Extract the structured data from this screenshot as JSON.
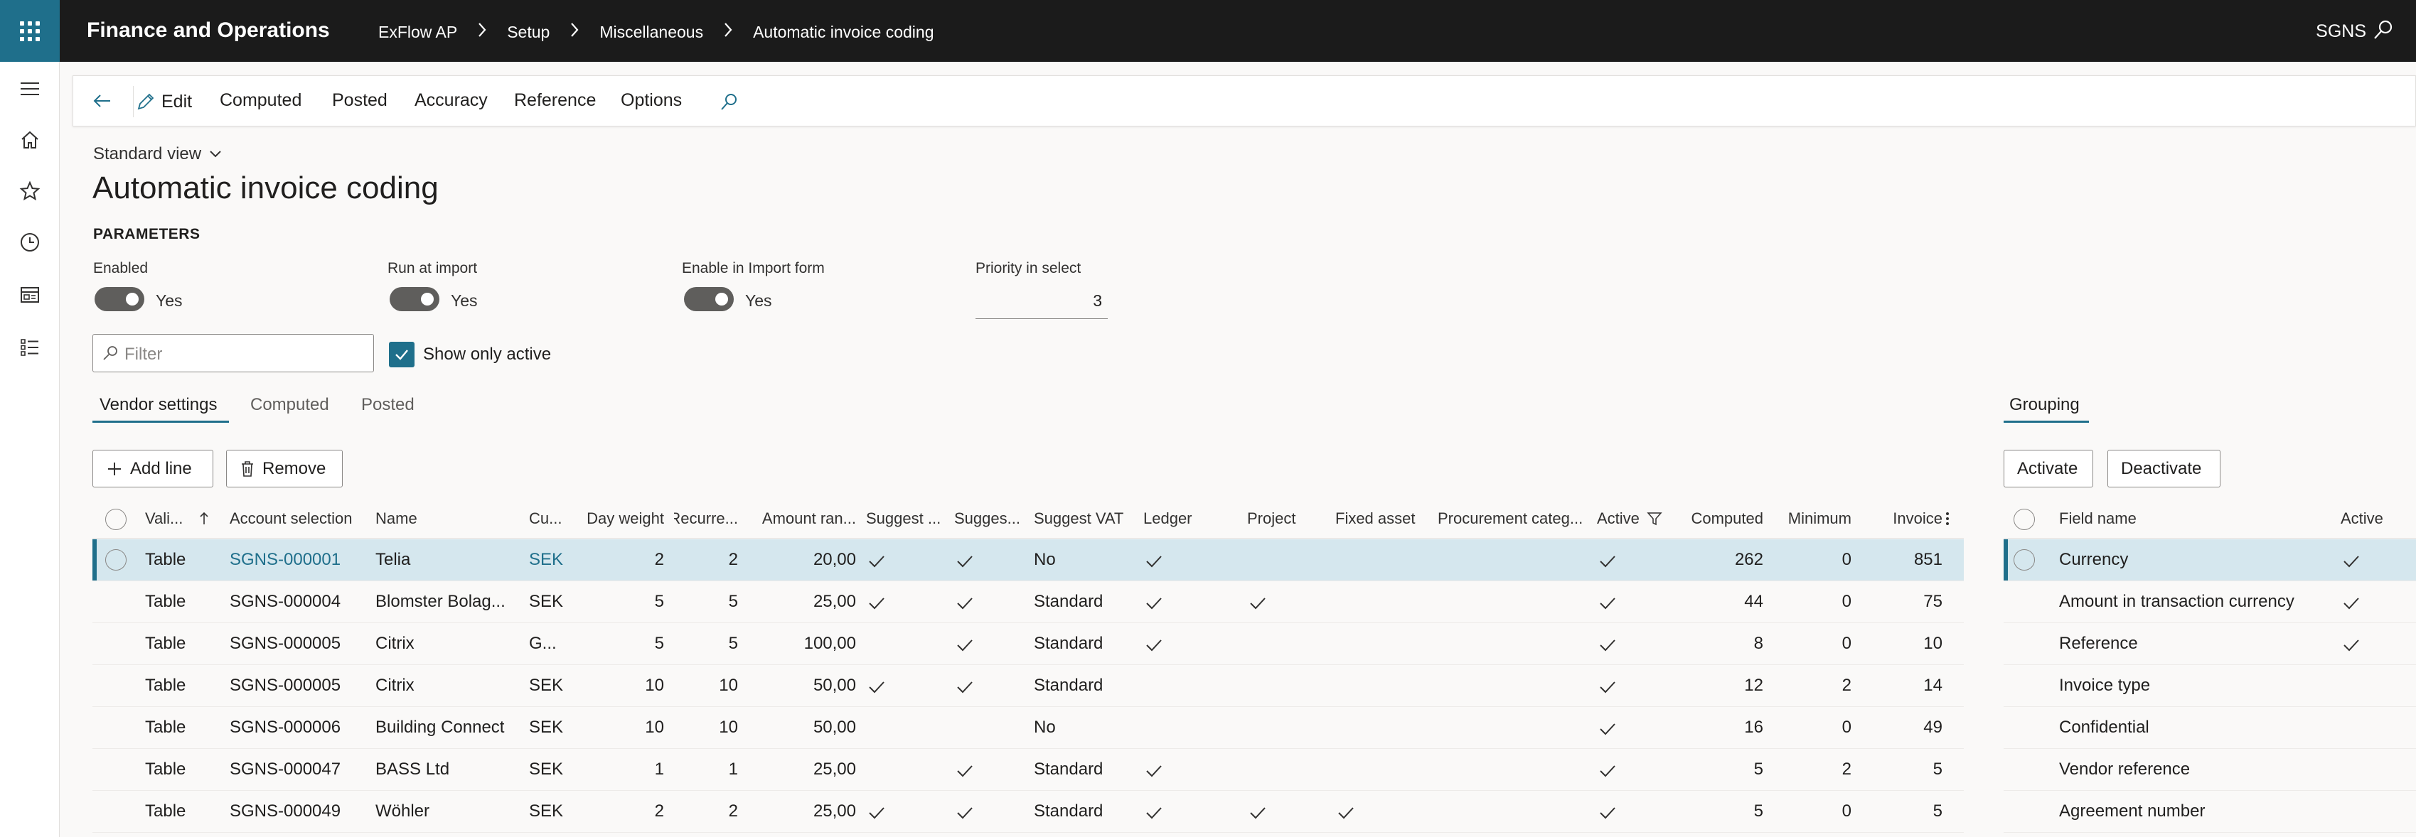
{
  "app": {
    "title": "Finance and Operations",
    "company": "SGNS"
  },
  "breadcrumb": [
    "ExFlow AP",
    "Setup",
    "Miscellaneous",
    "Automatic invoice coding"
  ],
  "actions": {
    "edit": "Edit",
    "computed": "Computed",
    "posted": "Posted",
    "accuracy": "Accuracy",
    "reference": "Reference",
    "options": "Options"
  },
  "view": {
    "name": "Standard view"
  },
  "page": {
    "title": "Automatic invoice coding"
  },
  "parameters": {
    "heading": "PARAMETERS",
    "enabled": {
      "label": "Enabled",
      "value": "Yes"
    },
    "run_at_import": {
      "label": "Run at import",
      "value": "Yes"
    },
    "enable_import_form": {
      "label": "Enable in Import form",
      "value": "Yes"
    },
    "priority": {
      "label": "Priority in select",
      "value": "3"
    }
  },
  "filter": {
    "placeholder": "Filter"
  },
  "show_only_active": {
    "label": "Show only active",
    "checked": true
  },
  "tabs": [
    "Vendor settings",
    "Computed",
    "Posted"
  ],
  "grouping_tab": "Grouping",
  "buttons": {
    "add_line": "Add line",
    "remove": "Remove",
    "activate": "Activate",
    "deactivate": "Deactivate"
  },
  "vendor_grid": {
    "headers": [
      "Vali...",
      "Account selection",
      "Name",
      "Cu...",
      "Day weight",
      "Recurre...",
      "Amount ran...",
      "Suggest ...",
      "Sugges...",
      "Suggest VAT",
      "Ledger",
      "Project",
      "Fixed asset",
      "Procurement categ...",
      "Active",
      "Computed",
      "Minimum",
      "Invoice"
    ],
    "rows": [
      {
        "valid": "Table",
        "account": "SGNS-000001",
        "name": "Telia",
        "currency": "SEK",
        "day_weight": "2",
        "recurrence": "2",
        "amount": "20,00",
        "s1": true,
        "s2": true,
        "vat": "No",
        "ledger": true,
        "project": false,
        "fixed": false,
        "active": true,
        "computed": "262",
        "minimum": "0",
        "invoice": "851",
        "selected": true
      },
      {
        "valid": "Table",
        "account": "SGNS-000004",
        "name": "Blomster Bolag...",
        "currency": "SEK",
        "day_weight": "5",
        "recurrence": "5",
        "amount": "25,00",
        "s1": true,
        "s2": true,
        "vat": "Standard",
        "ledger": true,
        "project": true,
        "fixed": false,
        "active": true,
        "computed": "44",
        "minimum": "0",
        "invoice": "75",
        "selected": false
      },
      {
        "valid": "Table",
        "account": "SGNS-000005",
        "name": "Citrix",
        "currency": "G...",
        "day_weight": "5",
        "recurrence": "5",
        "amount": "100,00",
        "s1": false,
        "s2": true,
        "vat": "Standard",
        "ledger": true,
        "project": false,
        "fixed": false,
        "active": true,
        "computed": "8",
        "minimum": "0",
        "invoice": "10",
        "selected": false
      },
      {
        "valid": "Table",
        "account": "SGNS-000005",
        "name": "Citrix",
        "currency": "SEK",
        "day_weight": "10",
        "recurrence": "10",
        "amount": "50,00",
        "s1": true,
        "s2": true,
        "vat": "Standard",
        "ledger": false,
        "project": false,
        "fixed": false,
        "active": true,
        "computed": "12",
        "minimum": "2",
        "invoice": "14",
        "selected": false
      },
      {
        "valid": "Table",
        "account": "SGNS-000006",
        "name": "Building Connect",
        "currency": "SEK",
        "day_weight": "10",
        "recurrence": "10",
        "amount": "50,00",
        "s1": false,
        "s2": false,
        "vat": "No",
        "ledger": false,
        "project": false,
        "fixed": false,
        "active": true,
        "computed": "16",
        "minimum": "0",
        "invoice": "49",
        "selected": false
      },
      {
        "valid": "Table",
        "account": "SGNS-000047",
        "name": "BASS Ltd",
        "currency": "SEK",
        "day_weight": "1",
        "recurrence": "1",
        "amount": "25,00",
        "s1": false,
        "s2": true,
        "vat": "Standard",
        "ledger": true,
        "project": false,
        "fixed": false,
        "active": true,
        "computed": "5",
        "minimum": "2",
        "invoice": "5",
        "selected": false
      },
      {
        "valid": "Table",
        "account": "SGNS-000049",
        "name": "Wöhler",
        "currency": "SEK",
        "day_weight": "2",
        "recurrence": "2",
        "amount": "25,00",
        "s1": true,
        "s2": true,
        "vat": "Standard",
        "ledger": true,
        "project": true,
        "fixed": true,
        "active": true,
        "computed": "5",
        "minimum": "0",
        "invoice": "5",
        "selected": false
      }
    ]
  },
  "grouping_grid": {
    "headers": [
      "Field name",
      "Active"
    ],
    "rows": [
      {
        "field": "Currency",
        "active": true,
        "selected": true
      },
      {
        "field": "Amount in transaction currency",
        "active": true,
        "selected": false
      },
      {
        "field": "Reference",
        "active": true,
        "selected": false
      },
      {
        "field": "Invoice type",
        "active": false,
        "selected": false
      },
      {
        "field": "Confidential",
        "active": false,
        "selected": false
      },
      {
        "field": "Vendor reference",
        "active": false,
        "selected": false
      },
      {
        "field": "Agreement number",
        "active": false,
        "selected": false
      }
    ]
  },
  "colors": {
    "accent": "#1f6f8b",
    "topbar": "#1b1b1b",
    "selected_row": "#d5e7ee"
  }
}
